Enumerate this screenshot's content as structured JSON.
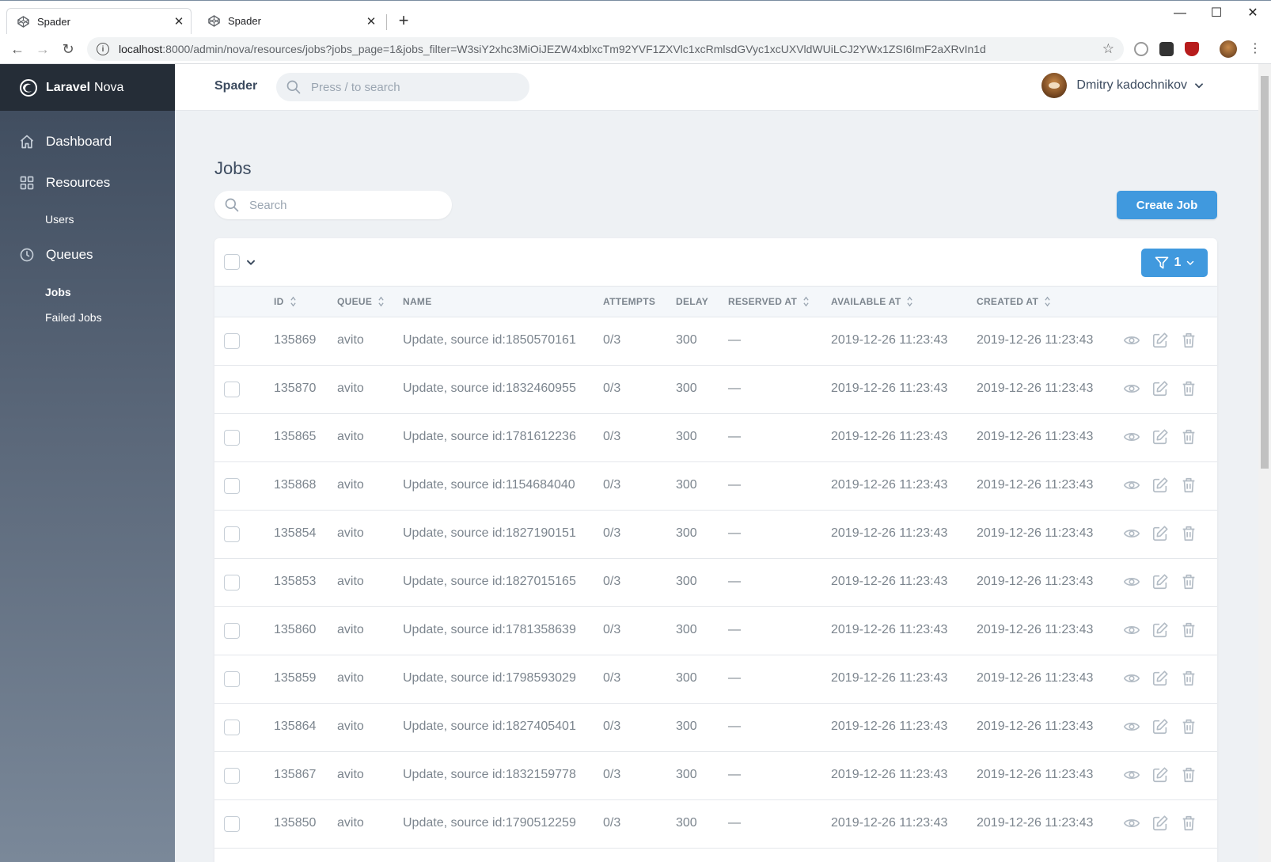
{
  "browser": {
    "tabs": [
      {
        "title": "Spader",
        "active": true
      },
      {
        "title": "Spader",
        "active": false
      }
    ],
    "url_host": "localhost",
    "url_rest": ":8000/admin/nova/resources/jobs?jobs_page=1&jobs_filter=W3siY2xhc3MiOiJEZW4xblxcTm92YVF1ZXVlc1xcRmlsdGVyc1xcUXVldWUiLCJ2YWx1ZSI6ImF2aXRvIn1d"
  },
  "sidebar": {
    "brand_bold": "Laravel",
    "brand_rest": "Nova",
    "dashboard": "Dashboard",
    "resources": "Resources",
    "users": "Users",
    "queues": "Queues",
    "jobs": "Jobs",
    "failed_jobs": "Failed Jobs"
  },
  "header": {
    "app_name": "Spader",
    "search_placeholder": "Press / to search",
    "user_name": "Dmitry kadochnikov"
  },
  "main": {
    "title": "Jobs",
    "search_placeholder": "Search",
    "create_label": "Create Job",
    "filter_count": "1"
  },
  "table": {
    "columns": {
      "id": "ID",
      "queue": "QUEUE",
      "name": "NAME",
      "attempts": "ATTEMPTS",
      "delay": "DELAY",
      "reserved_at": "RESERVED AT",
      "available_at": "AVAILABLE AT",
      "created_at": "CREATED AT"
    },
    "rows": [
      {
        "id": "135869",
        "queue": "avito",
        "name": "Update, source id:1850570161",
        "attempts": "0/3",
        "delay": "300",
        "reserved_at": "—",
        "available_at": "2019-12-26 11:23:43",
        "created_at": "2019-12-26 11:23:43"
      },
      {
        "id": "135870",
        "queue": "avito",
        "name": "Update, source id:1832460955",
        "attempts": "0/3",
        "delay": "300",
        "reserved_at": "—",
        "available_at": "2019-12-26 11:23:43",
        "created_at": "2019-12-26 11:23:43"
      },
      {
        "id": "135865",
        "queue": "avito",
        "name": "Update, source id:1781612236",
        "attempts": "0/3",
        "delay": "300",
        "reserved_at": "—",
        "available_at": "2019-12-26 11:23:43",
        "created_at": "2019-12-26 11:23:43"
      },
      {
        "id": "135868",
        "queue": "avito",
        "name": "Update, source id:1154684040",
        "attempts": "0/3",
        "delay": "300",
        "reserved_at": "—",
        "available_at": "2019-12-26 11:23:43",
        "created_at": "2019-12-26 11:23:43"
      },
      {
        "id": "135854",
        "queue": "avito",
        "name": "Update, source id:1827190151",
        "attempts": "0/3",
        "delay": "300",
        "reserved_at": "—",
        "available_at": "2019-12-26 11:23:43",
        "created_at": "2019-12-26 11:23:43"
      },
      {
        "id": "135853",
        "queue": "avito",
        "name": "Update, source id:1827015165",
        "attempts": "0/3",
        "delay": "300",
        "reserved_at": "—",
        "available_at": "2019-12-26 11:23:43",
        "created_at": "2019-12-26 11:23:43"
      },
      {
        "id": "135860",
        "queue": "avito",
        "name": "Update, source id:1781358639",
        "attempts": "0/3",
        "delay": "300",
        "reserved_at": "—",
        "available_at": "2019-12-26 11:23:43",
        "created_at": "2019-12-26 11:23:43"
      },
      {
        "id": "135859",
        "queue": "avito",
        "name": "Update, source id:1798593029",
        "attempts": "0/3",
        "delay": "300",
        "reserved_at": "—",
        "available_at": "2019-12-26 11:23:43",
        "created_at": "2019-12-26 11:23:43"
      },
      {
        "id": "135864",
        "queue": "avito",
        "name": "Update, source id:1827405401",
        "attempts": "0/3",
        "delay": "300",
        "reserved_at": "—",
        "available_at": "2019-12-26 11:23:43",
        "created_at": "2019-12-26 11:23:43"
      },
      {
        "id": "135867",
        "queue": "avito",
        "name": "Update, source id:1832159778",
        "attempts": "0/3",
        "delay": "300",
        "reserved_at": "—",
        "available_at": "2019-12-26 11:23:43",
        "created_at": "2019-12-26 11:23:43"
      },
      {
        "id": "135850",
        "queue": "avito",
        "name": "Update, source id:1790512259",
        "attempts": "0/3",
        "delay": "300",
        "reserved_at": "—",
        "available_at": "2019-12-26 11:23:43",
        "created_at": "2019-12-26 11:23:43"
      }
    ],
    "row_icons": [
      "eye-icon",
      "edit-icon",
      "trash-icon"
    ]
  },
  "colors": {
    "accent": "#4099de",
    "sidebar_top": "#3d4a5c",
    "brand_bar": "#252d37",
    "text": "#3c4b5f",
    "muted": "#7c858e"
  }
}
